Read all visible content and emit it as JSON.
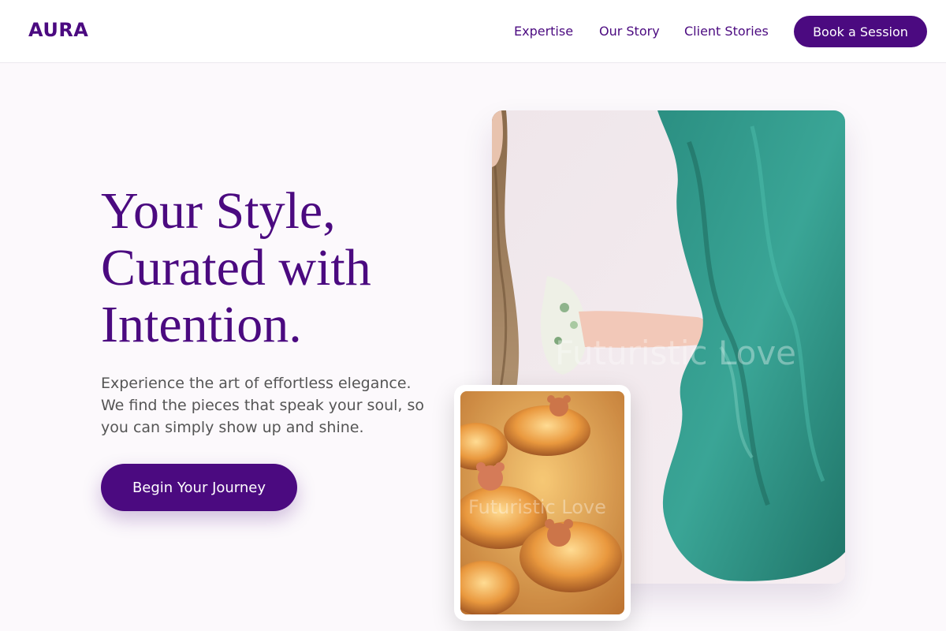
{
  "brand": {
    "name": "AURA"
  },
  "nav": {
    "links": [
      {
        "label": "Expertise"
      },
      {
        "label": "Our Story"
      },
      {
        "label": "Client Stories"
      }
    ],
    "cta_label": "Book a Session"
  },
  "hero": {
    "title_lines": [
      "Your Style,",
      "Curated with",
      "Intention."
    ],
    "subtitle_lines": [
      "Experience the art of effortless elegance.",
      "We find the pieces that speak your soul, so",
      "you can simply show up and shine."
    ],
    "cta_label": "Begin Your Journey"
  },
  "images": {
    "main_watermark": "Futuristic Love",
    "secondary_watermark": "Futuristic Love"
  },
  "colors": {
    "brand_purple": "#4b0a80",
    "background": "#fcf9fc",
    "text_gray": "#555555",
    "teal_fabric": "#2e9a8a"
  }
}
